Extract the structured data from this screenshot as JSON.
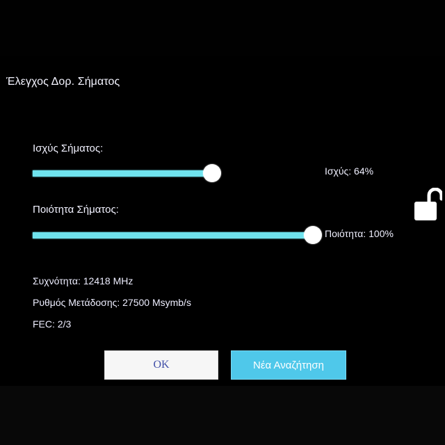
{
  "dialog": {
    "title": "Έλεγχος Δορ. Σήματος"
  },
  "signal_strength": {
    "label": "Ισχύς Σήματος:",
    "readout": "Ισχύς: 64%",
    "percent": 64
  },
  "signal_quality": {
    "label": "Ποιότητα Σήματος:",
    "readout": "Ποιότητα: 100%",
    "percent": 100
  },
  "info": {
    "frequency": "Συχνότητα: 12418 MHz",
    "symbol_rate": "Ρυθμός Μετάδοσης: 27500 Msymb/s",
    "fec": "FEC: 2/3"
  },
  "lock_icon": "unlocked-padlock-icon",
  "buttons": {
    "ok": "OK",
    "new_search": "Νέα Αναζήτηση"
  },
  "colors": {
    "bar_fill": "#6fe3ee",
    "search_button": "#4fc8ea",
    "background": "#000000"
  }
}
